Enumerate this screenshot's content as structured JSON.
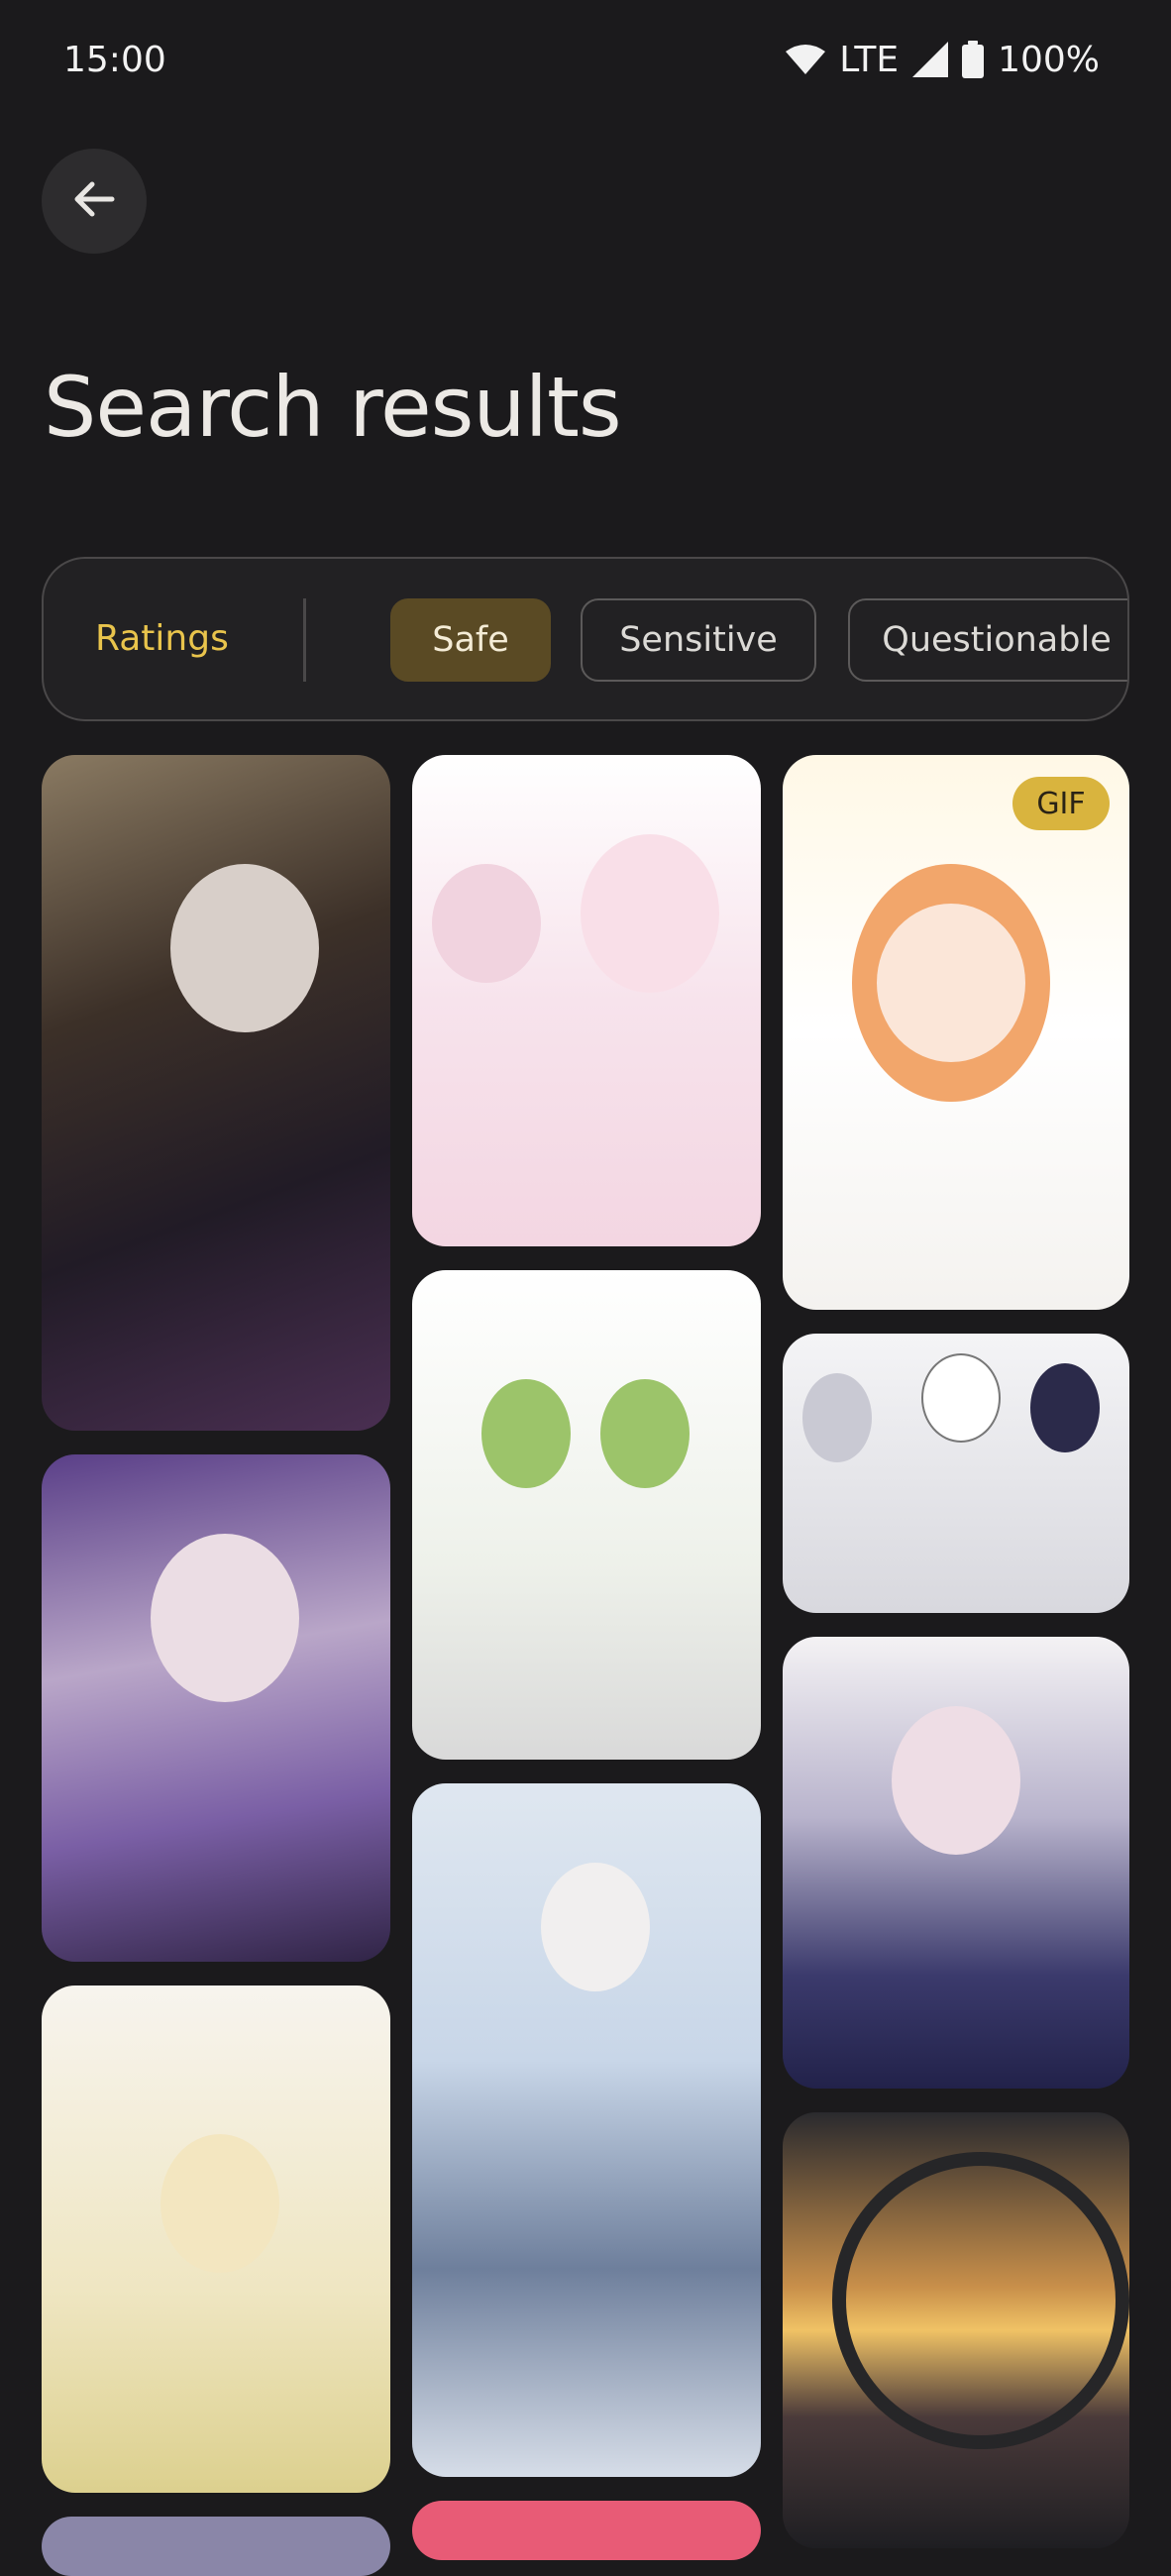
{
  "status_bar": {
    "time": "15:00",
    "network": "LTE",
    "battery": "100%"
  },
  "header": {
    "title": "Search results"
  },
  "filters": {
    "label": "Ratings",
    "chips": [
      {
        "label": "Safe",
        "selected": true
      },
      {
        "label": "Sensitive",
        "selected": false
      },
      {
        "label": "Questionable",
        "selected": false
      }
    ]
  },
  "results": {
    "gif_badge": "GIF",
    "icons": {
      "back": "arrow-left-icon",
      "wifi": "wifi-icon",
      "signal": "signal-icon",
      "battery": "battery-icon"
    }
  },
  "colors": {
    "background": "#1b1a1c",
    "accent": "#e9c44c",
    "selected_chip": "#5a4a24"
  }
}
